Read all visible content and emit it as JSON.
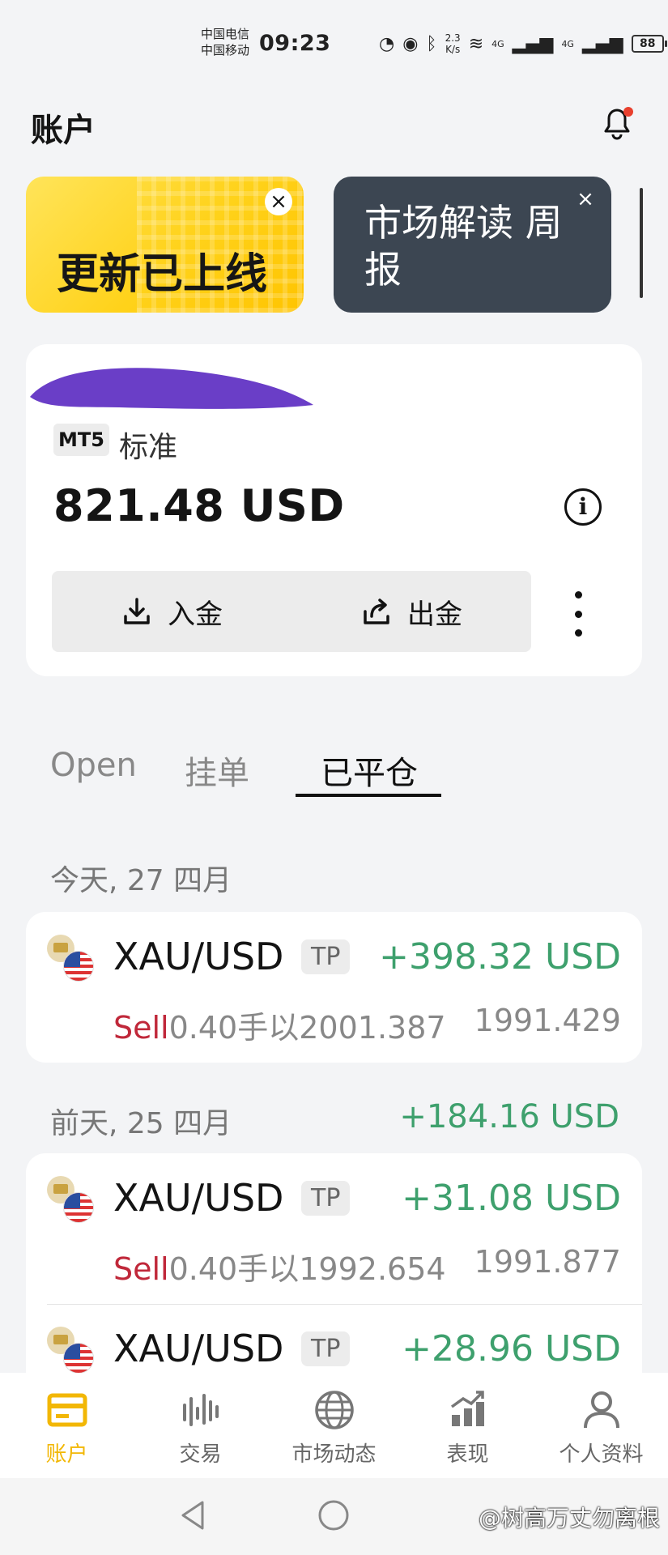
{
  "status_bar": {
    "carrier1": "中国电信",
    "carrier2": "中国移动",
    "time": "09:23",
    "net_speed_value": "2.3",
    "net_speed_unit": "K/s",
    "sig1": "4G",
    "sig2": "4G",
    "battery": "88"
  },
  "header": {
    "title": "账户"
  },
  "banners": [
    {
      "text": "更新已上线",
      "close": "×"
    },
    {
      "text": "市场解读 周报",
      "close": "×"
    }
  ],
  "account": {
    "platform_badge": "MT5",
    "type": "标准",
    "balance": "821.48 USD",
    "info_icon": "i",
    "deposit_label": "入金",
    "withdraw_label": "出金"
  },
  "tabs": [
    {
      "label": "Open",
      "active": false
    },
    {
      "label": "挂单",
      "active": false
    },
    {
      "label": "已平仓",
      "active": true
    }
  ],
  "groups": [
    {
      "date": "今天, 27 四月",
      "total": "",
      "trades": [
        {
          "symbol": "XAU/USD",
          "badge": "TP",
          "pnl": "+398.32 USD",
          "side": "Sell",
          "lots_text": "0.40手以2001.387",
          "close_price": "1991.429"
        }
      ]
    },
    {
      "date": "前天, 25 四月",
      "total": "+184.16 USD",
      "trades": [
        {
          "symbol": "XAU/USD",
          "badge": "TP",
          "pnl": "+31.08 USD",
          "side": "Sell",
          "lots_text": "0.40手以1992.654",
          "close_price": "1991.877"
        },
        {
          "symbol": "XAU/USD",
          "badge": "TP",
          "pnl": "+28.96 USD",
          "side": "",
          "lots_text": "",
          "close_price": ""
        }
      ]
    }
  ],
  "bottom_nav": [
    {
      "label": "账户",
      "icon": "wallet-icon",
      "active": true
    },
    {
      "label": "交易",
      "icon": "chart-bars-icon",
      "active": false
    },
    {
      "label": "市场动态",
      "icon": "globe-icon",
      "active": false
    },
    {
      "label": "表现",
      "icon": "performance-icon",
      "active": false
    },
    {
      "label": "个人资料",
      "icon": "person-icon",
      "active": false
    }
  ],
  "watermark": "@树高万丈勿离根",
  "colors": {
    "accent": "#f2b705",
    "profit": "#3ea06d",
    "sell": "#c0283a",
    "banner_dark": "#3c4652"
  }
}
